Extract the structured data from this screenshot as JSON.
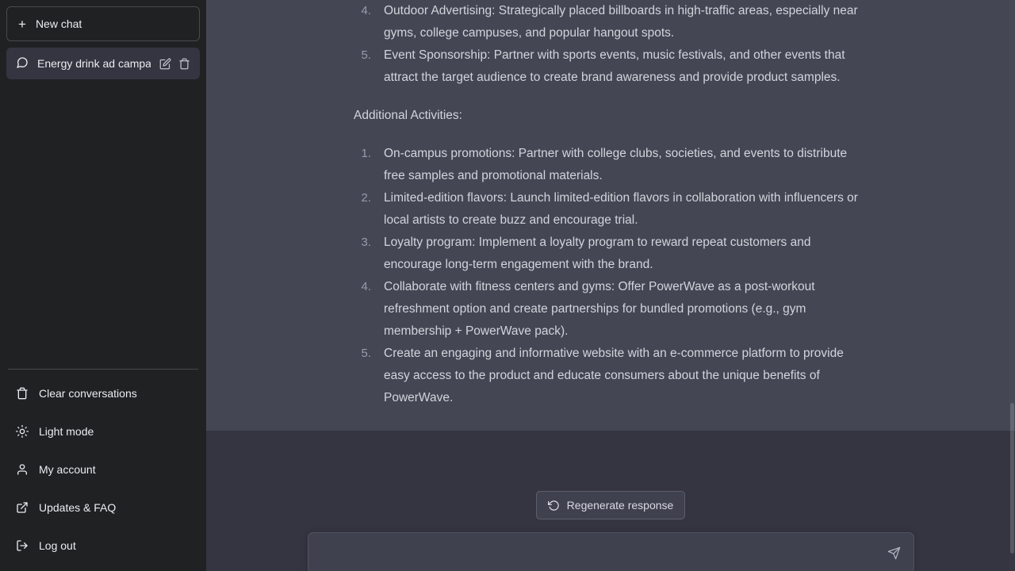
{
  "sidebar": {
    "new_chat": {
      "label": "New chat",
      "icon": "plus-icon"
    },
    "conversations": [
      {
        "title": "Energy drink ad campai",
        "icon": "chat-bubble-icon",
        "active": true,
        "edit_icon": "pencil-icon",
        "delete_icon": "trash-icon"
      }
    ],
    "menu": [
      {
        "label": "Clear conversations",
        "icon": "trash-icon"
      },
      {
        "label": "Light mode",
        "icon": "sun-icon"
      },
      {
        "label": "My account",
        "icon": "person-icon"
      },
      {
        "label": "Updates & FAQ",
        "icon": "external-link-icon"
      },
      {
        "label": "Log out",
        "icon": "logout-icon"
      }
    ]
  },
  "message": {
    "top_list": [
      {
        "num": "4.",
        "text": "Outdoor Advertising: Strategically placed billboards in high-traffic areas, especially near gyms, college campuses, and popular hangout spots."
      },
      {
        "num": "5.",
        "text": "Event Sponsorship: Partner with sports events, music festivals, and other events that attract the target audience to create brand awareness and provide product samples."
      }
    ],
    "heading": "Additional Activities:",
    "bottom_list": [
      {
        "num": "1.",
        "text": "On-campus promotions: Partner with college clubs, societies, and events to distribute free samples and promotional materials."
      },
      {
        "num": "2.",
        "text": "Limited-edition flavors: Launch limited-edition flavors in collaboration with influencers or local artists to create buzz and encourage trial."
      },
      {
        "num": "3.",
        "text": "Loyalty program: Implement a loyalty program to reward repeat customers and encourage long-term engagement with the brand."
      },
      {
        "num": "4.",
        "text": "Collaborate with fitness centers and gyms: Offer PowerWave as a post-workout refreshment option and create partnerships for bundled promotions (e.g., gym membership + PowerWave pack)."
      },
      {
        "num": "5.",
        "text": "Create an engaging and informative website with an e-commerce platform to provide easy access to the product and educate consumers about the unique benefits of PowerWave."
      }
    ]
  },
  "footer": {
    "regenerate": {
      "label": "Regenerate response",
      "icon": "refresh-icon"
    },
    "composer": {
      "value": "",
      "placeholder": "",
      "send_icon": "send-icon"
    }
  },
  "colors": {
    "sidebar_bg": "#202123",
    "page_bg": "#343541",
    "message_bg": "#444654",
    "text": "#d1d5db",
    "muted": "#9a9aab",
    "composer_bg": "#40414f"
  }
}
